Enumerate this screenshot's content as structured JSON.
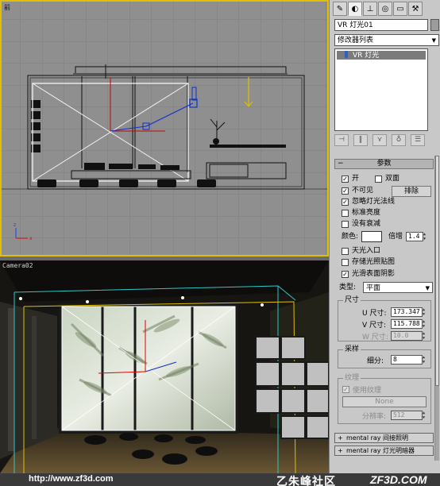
{
  "top_view": {
    "label": "前"
  },
  "camera_view": {
    "label": "Camera02"
  },
  "footer": {
    "url": "http://www.zf3d.com",
    "logo": "乙朱峰社区",
    "logo_site": "ZF3D.COM"
  },
  "panel": {
    "tabs": [
      "create-icon",
      "modify-icon",
      "hierarchy-icon",
      "motion-icon",
      "display-icon",
      "utilities-icon"
    ],
    "object_name": "VR 灯光01",
    "modifier_list": "修改器列表",
    "stack_item": "VR 灯光",
    "params": {
      "header": "参数",
      "on_label": "开",
      "on_checked": true,
      "double_sided_label": "双面",
      "double_sided_checked": false,
      "invisible_label": "不可见",
      "invisible_checked": true,
      "exclude_label": "排除",
      "ignore_normals_label": "忽略灯光法线",
      "ignore_normals_checked": true,
      "normalize_label": "标准亮度",
      "normalize_checked": false,
      "no_decay_label": "没有衰减",
      "no_decay_checked": false,
      "color_label": "颜色:",
      "color_value": "#ffffff",
      "multiplier_label": "倍增",
      "multiplier_value": "1.4",
      "skylight_label": "天光入口",
      "skylight_checked": false,
      "store_irr_label": "存储光照贴图",
      "store_irr_checked": false,
      "smooth_shadows_label": "光滑表面阴影",
      "smooth_shadows_checked": true,
      "type_label": "类型:",
      "type_value": "平面",
      "size_group": "尺寸",
      "u_label": "U 尺寸:",
      "u_value": "173.347",
      "v_label": "V 尺寸:",
      "v_value": "115.788",
      "w_label": "W 尺寸:",
      "w_value": "10.0",
      "sampling_group": "采样",
      "subdivs_label": "细分:",
      "subdivs_value": "8",
      "texture_group": "纹理",
      "use_texture_label": "使用纹理",
      "use_texture_checked": true,
      "none_button": "None",
      "resolution_label": "分辨率:",
      "resolution_value": "512"
    },
    "rollouts": [
      "mental ray 间接照明",
      "mental ray 灯光明暗器"
    ]
  }
}
